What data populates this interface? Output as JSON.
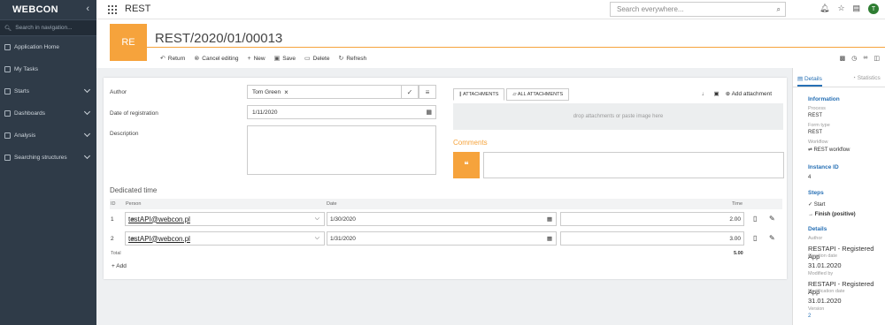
{
  "sidebar": {
    "logo": "WEBCON",
    "search_placeholder": "Search in navigation...",
    "items": [
      {
        "label": "Application Home"
      },
      {
        "label": "My Tasks"
      },
      {
        "label": "Starts"
      },
      {
        "label": "Dashboards"
      },
      {
        "label": "Analysis"
      },
      {
        "label": "Searching structures"
      }
    ]
  },
  "topbar": {
    "app_name": "REST",
    "search_placeholder": "Search everywhere...",
    "user_initial": "T"
  },
  "header": {
    "badge": "RE",
    "title": "REST/2020/01/00013",
    "toolbar": {
      "return": "Return",
      "cancel": "Cancel editing",
      "new": "New",
      "save": "Save",
      "delete": "Delete",
      "refresh": "Refresh"
    }
  },
  "form": {
    "author_label": "Author",
    "author_value": "Tom Green",
    "date_label": "Date of registration",
    "date_value": "1/11/2020",
    "description_label": "Description",
    "attachments_tab": "ATTACHMENTS",
    "all_attachments_tab": "ALL ATTACHMENTS",
    "add_attachment": "Add attachment",
    "drop_text": "drop attachments or paste image here",
    "comments_label": "Comments"
  },
  "dedicated_time": {
    "title": "Dedicated time",
    "columns": {
      "id": "ID",
      "person": "Person",
      "date": "Date",
      "time": "Time"
    },
    "rows": [
      {
        "id": "1",
        "person": "testAPI@webcon.pl",
        "date": "1/30/2020",
        "time": "2.00"
      },
      {
        "id": "2",
        "person": "testAPI@webcon.pl",
        "date": "1/31/2020",
        "time": "3.00"
      }
    ],
    "total_label": "Total",
    "total_value": "5.00",
    "add_label": "Add"
  },
  "details_panel": {
    "tab_details": "Details",
    "tab_statistics": "Statistics",
    "information_h": "Information",
    "process_label": "Process",
    "process_value": "REST",
    "form_type_label": "Form type",
    "form_type_value": "REST",
    "workflow_label": "Workflow",
    "workflow_value": "REST workflow",
    "instance_h": "Instance ID",
    "instance_value": "4",
    "steps_h": "Steps",
    "step_start": "Start",
    "step_finish": "Finish (positive)",
    "details_h": "Details",
    "author_label": "Author",
    "author_value": "RESTAPI - Registered App",
    "creation_label": "Creation date",
    "creation_value": "31.01.2020",
    "modified_label": "Modified by",
    "modified_value": "RESTAPI - Registered App",
    "modification_label": "Modification date",
    "modification_value": "31.01.2020",
    "version_label": "Version",
    "version_value": "2"
  }
}
